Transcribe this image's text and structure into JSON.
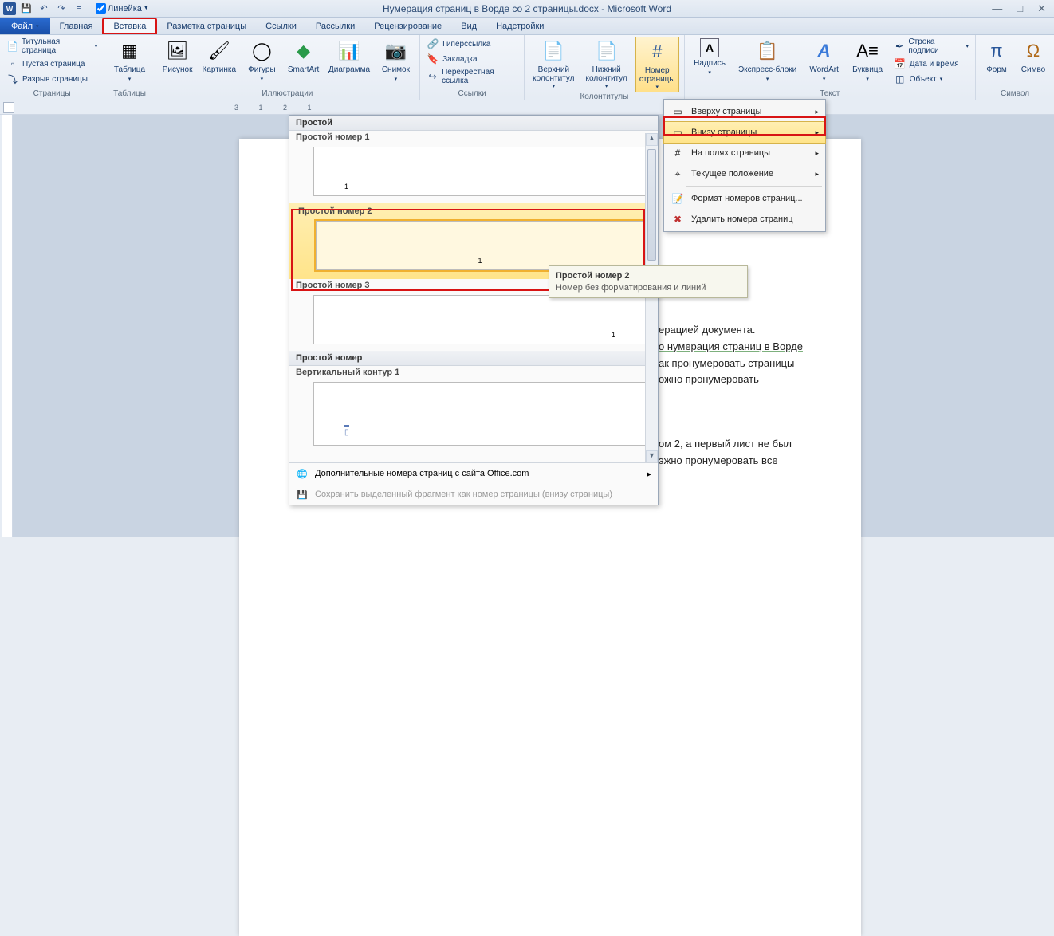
{
  "title": "Нумерация страниц в Ворде со 2 страницы.docx - Microsoft Word",
  "qat_ruler_label": "Линейка",
  "tabs": {
    "file": "Файл",
    "home": "Главная",
    "insert": "Вставка",
    "layout": "Разметка страницы",
    "refs": "Ссылки",
    "mail": "Рассылки",
    "review": "Рецензирование",
    "view": "Вид",
    "addins": "Надстройки"
  },
  "ribbon": {
    "pages": {
      "cover": "Титульная страница",
      "blank": "Пустая страница",
      "break": "Разрыв страницы",
      "group": "Страницы"
    },
    "tables": {
      "btn": "Таблица",
      "group": "Таблицы"
    },
    "illus": {
      "pic": "Рисунок",
      "clip": "Картинка",
      "shapes": "Фигуры",
      "smartart": "SmartArt",
      "chart": "Диаграмма",
      "screenshot": "Снимок",
      "group": "Иллюстрации"
    },
    "links": {
      "hyper": "Гиперссылка",
      "bookmark": "Закладка",
      "xref": "Перекрестная ссылка",
      "group": "Ссылки"
    },
    "hf": {
      "header": "Верхний\nколонтитул",
      "footer": "Нижний\nколонтитул",
      "pnum": "Номер\nстраницы",
      "group": "Колонтитулы"
    },
    "text": {
      "textbox": "Надпись",
      "quick": "Экспресс-блоки",
      "wordart": "WordArt",
      "dropcap": "Буквица",
      "sig": "Строка подписи",
      "date": "Дата и время",
      "obj": "Объект",
      "group": "Текст"
    },
    "symbols": {
      "eq": "Форм",
      "sym": "Симво",
      "group": "Символ"
    }
  },
  "submenu": {
    "top": "Вверху страницы",
    "bottom": "Внизу страницы",
    "margins": "На полях страницы",
    "current": "Текущее положение",
    "format": "Формат номеров страниц...",
    "remove": "Удалить номера страниц"
  },
  "gallery": {
    "hdr": "Простой",
    "item1": "Простой номер 1",
    "item2": "Простой номер 2",
    "item3": "Простой номер 3",
    "hdr2_section": "Простой номер",
    "hdr2": "Вертикальный контур 1",
    "more": "Дополнительные номера страниц с сайта Office.com",
    "save": "Сохранить выделенный фрагмент как номер страницы (внизу страницы)"
  },
  "tooltip": {
    "title": "Простой номер 2",
    "body": "Номер без форматирования и линий"
  },
  "page_text": {
    "l1": "ерацией документа.",
    "l2": "о нумерация страниц в Ворде",
    "l3": "ак пронумеровать страницы",
    "l4": "ожно пронумеровать",
    "l5": "ом 2, а первый лист не был",
    "l6": "эжно пронумеровать все"
  }
}
